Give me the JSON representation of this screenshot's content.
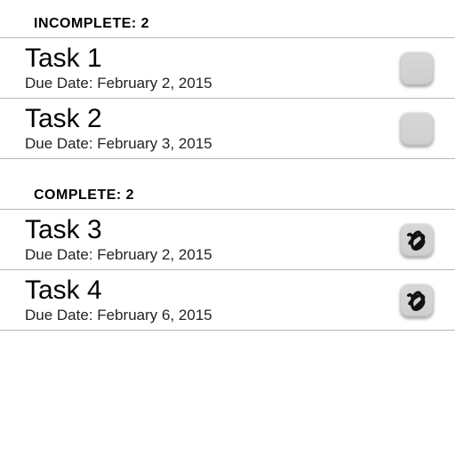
{
  "sections": [
    {
      "header": "INCOMPLETE: 2",
      "items": [
        {
          "title": "Task 1",
          "sub": "Due Date: February 2, 2015",
          "checked": false
        },
        {
          "title": "Task 2",
          "sub": "Due Date: February 3, 2015",
          "checked": false
        }
      ]
    },
    {
      "header": "COMPLETE: 2",
      "items": [
        {
          "title": "Task 3",
          "sub": "Due Date: February 2, 2015",
          "checked": true
        },
        {
          "title": "Task 4",
          "sub": "Due Date: February 6, 2015",
          "checked": true
        }
      ]
    }
  ]
}
